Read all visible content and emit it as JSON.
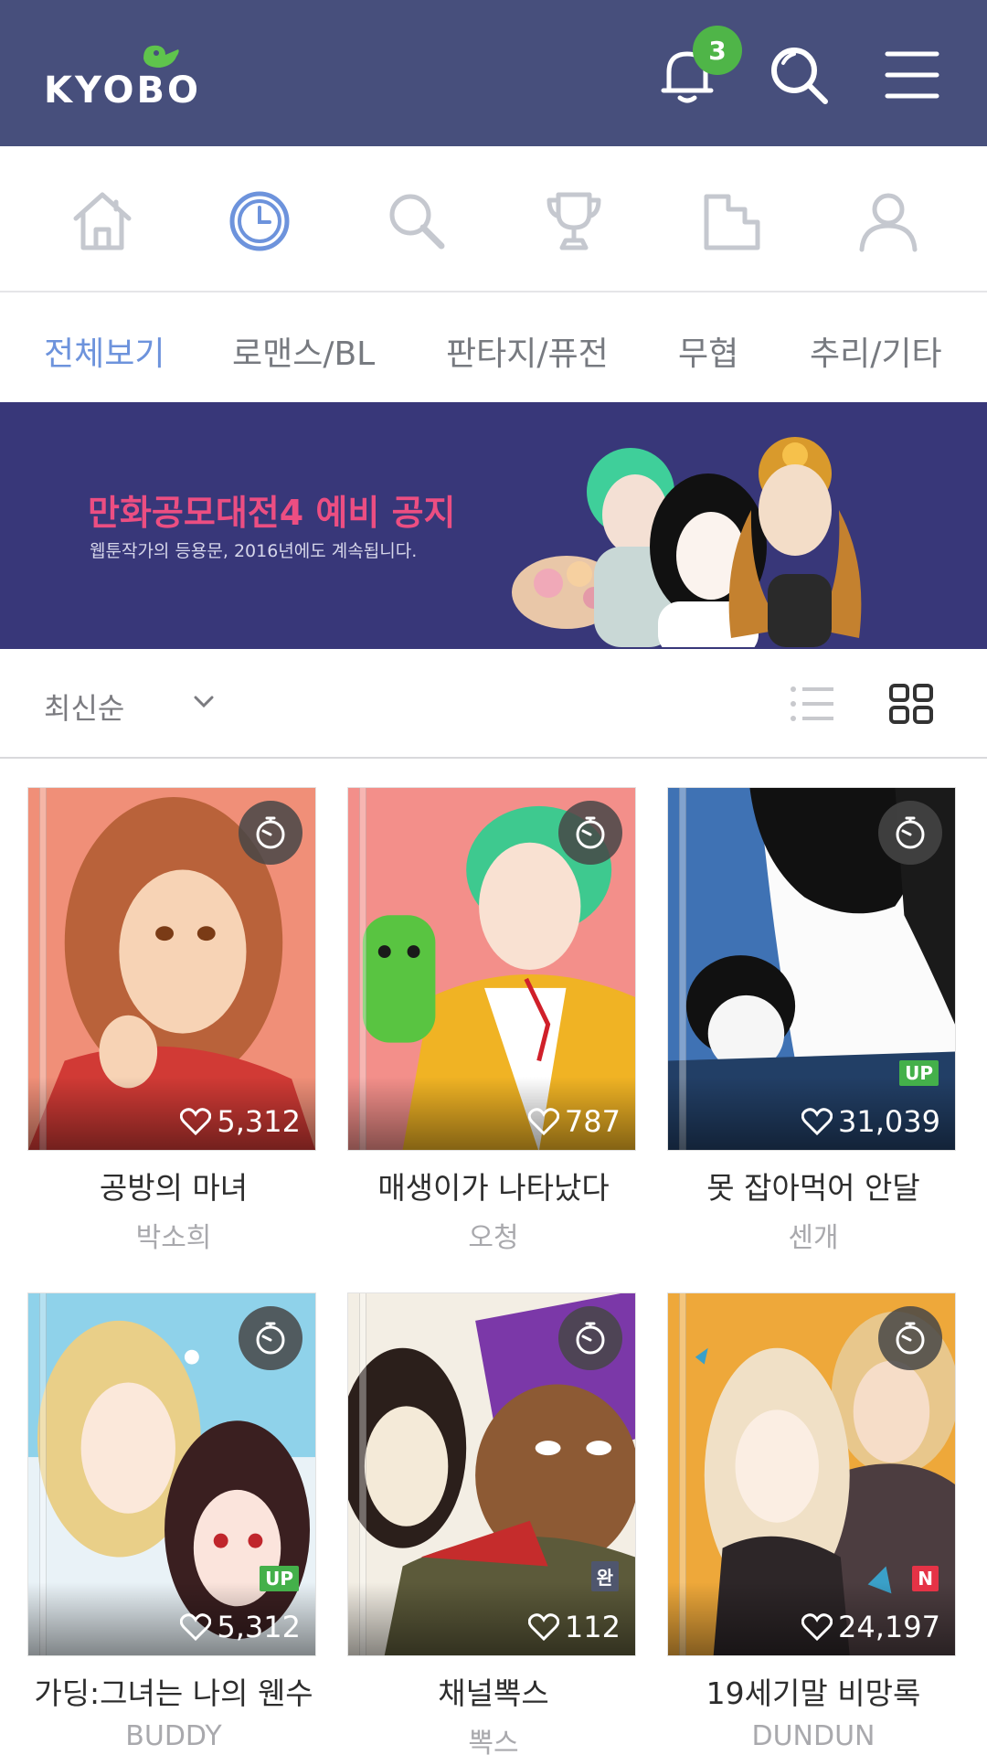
{
  "header": {
    "logo_text": "KYOBO",
    "notification_count": "3",
    "colors": {
      "bar": "#474f7c",
      "badge": "#4fb548"
    },
    "icons": [
      "bell-icon",
      "search-icon",
      "menu-icon"
    ]
  },
  "nav": {
    "icons": [
      "home-icon",
      "clock-icon",
      "search-icon",
      "trophy-icon",
      "bookmark-icon",
      "user-icon"
    ],
    "active": "clock-icon"
  },
  "tabs": [
    {
      "label": "전체보기",
      "active": true
    },
    {
      "label": "로맨스/BL",
      "active": false
    },
    {
      "label": "판타지/퓨전",
      "active": false
    },
    {
      "label": "무협",
      "active": false
    },
    {
      "label": "추리/기타",
      "active": false
    }
  ],
  "banner": {
    "title": "만화공모대전4 예비 공지",
    "subtitle": "웹툰작가의 등용문, 2016년에도 계속됩니다."
  },
  "sort": {
    "selected": "최신순",
    "views": [
      "list-view-icon",
      "grid-view-icon"
    ],
    "active_view": "grid-view-icon"
  },
  "titles": [
    {
      "title": "공방의 마녀",
      "author": "박소희",
      "likes": "5,312",
      "tag": ""
    },
    {
      "title": "매생이가 나타났다",
      "author": "오청",
      "likes": "787",
      "tag": ""
    },
    {
      "title": "못 잡아먹어 안달",
      "author": "센개",
      "likes": "31,039",
      "tag": "UP"
    },
    {
      "title": "가딩:그녀는 나의 웬수",
      "author": "BUDDY",
      "likes": "5,312",
      "tag": "UP"
    },
    {
      "title": "채널뽁스",
      "author": "뽁스",
      "likes": "112",
      "tag": "완"
    },
    {
      "title": "19세기말 비망록",
      "author": "DUNDUN",
      "likes": "24,197",
      "tag": "N"
    }
  ]
}
